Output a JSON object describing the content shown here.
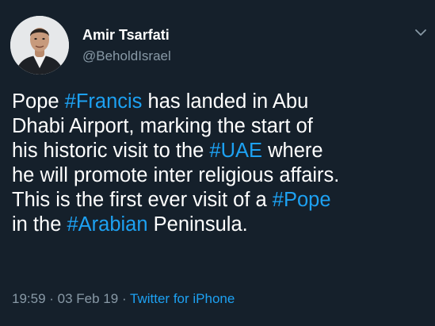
{
  "author": {
    "display_name": "Amir Tsarfati",
    "handle": "@BeholdIsrael"
  },
  "tweet": {
    "lines": [
      [
        {
          "text": "Pope ",
          "tag": false
        },
        {
          "text": "#Francis",
          "tag": true
        },
        {
          "text": " has landed in Abu",
          "tag": false
        }
      ],
      [
        {
          "text": "Dhabi Airport, marking the start of",
          "tag": false
        }
      ],
      [
        {
          "text": "his historic visit to the ",
          "tag": false
        },
        {
          "text": "#UAE",
          "tag": true
        },
        {
          "text": " where",
          "tag": false
        }
      ],
      [
        {
          "text": "he will promote inter religious affairs.",
          "tag": false
        }
      ],
      [
        {
          "text": "This is the first ever visit of a ",
          "tag": false
        },
        {
          "text": "#Pope",
          "tag": true
        }
      ],
      [
        {
          "text": "in the ",
          "tag": false
        },
        {
          "text": "#Arabian",
          "tag": true
        },
        {
          "text": " Peninsula.",
          "tag": false
        }
      ]
    ]
  },
  "meta": {
    "time": "19:59",
    "separator": " · ",
    "date": "03 Feb 19",
    "client": "Twitter for iPhone"
  },
  "colors": {
    "background": "#15202b",
    "text": "#ffffff",
    "secondary": "#8899a6",
    "accent": "#1da1f2"
  },
  "icons": {
    "menu": "chevron-down-icon",
    "avatar": "profile-photo"
  }
}
